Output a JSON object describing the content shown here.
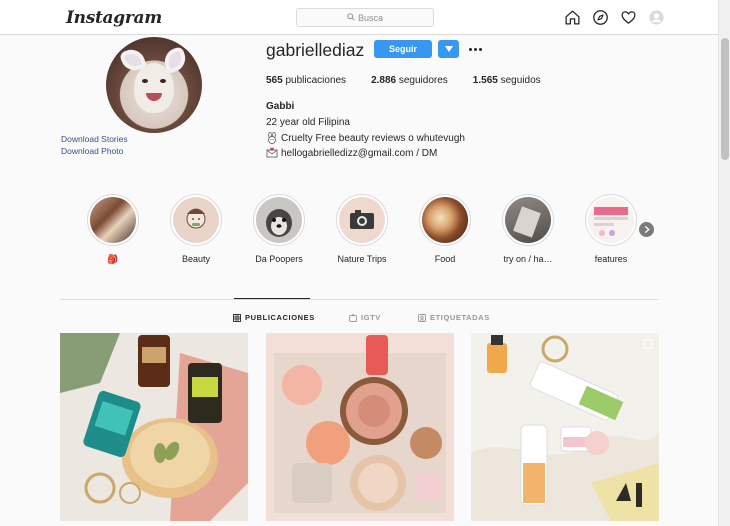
{
  "nav": {
    "logo": "Instagram",
    "search_placeholder": "Busca",
    "icons": [
      "home-icon",
      "explore-icon",
      "heart-icon",
      "profile-icon"
    ]
  },
  "profile": {
    "username": "gabriellediaz",
    "follow_label": "Seguir",
    "posts_count": "565",
    "posts_label": " publicaciones",
    "followers_count": "2.886",
    "followers_label": " seguidores",
    "following_count": "1.565",
    "following_label": " seguidos",
    "name": "Gabbi",
    "bio_line1": "22 year old Filipina",
    "bio_line2": "Cruelty Free beauty reviews o whutevugh",
    "bio_line3": "hellogabrielledizz@gmail.com / DM",
    "download_stories": "Download Stories",
    "download_photo": "Download Photo"
  },
  "highlights": [
    {
      "label": "🎒"
    },
    {
      "label": "Beauty"
    },
    {
      "label": "Da Poopers"
    },
    {
      "label": "Nature Trips"
    },
    {
      "label": "Food"
    },
    {
      "label": "try on / ha…"
    },
    {
      "label": "features"
    }
  ],
  "tabs": {
    "publications": "PUBLICACIONES",
    "igtv": "IGTV",
    "tagged": "ETIQUETADAS"
  },
  "colors": {
    "accent": "#3897f0",
    "link": "#385185",
    "border": "#dbdbdb"
  }
}
